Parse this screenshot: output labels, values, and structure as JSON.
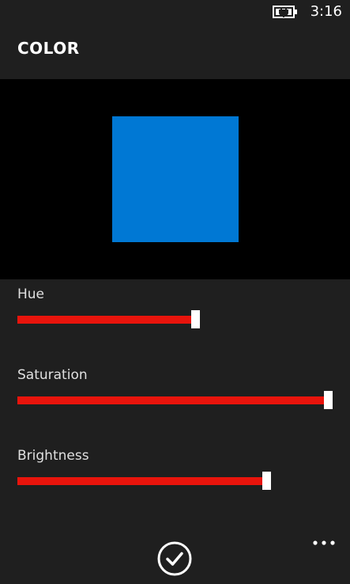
{
  "status_bar": {
    "time": "3:16",
    "battery_icon": "battery-charging-icon"
  },
  "header": {
    "title": "COLOR"
  },
  "preview": {
    "color": "#0078d4"
  },
  "sliders": [
    {
      "label": "Hue",
      "value": 0.565,
      "fill_color": "#e8140c"
    },
    {
      "label": "Saturation",
      "value": 0.985,
      "fill_color": "#e8140c"
    },
    {
      "label": "Brightness",
      "value": 0.79,
      "fill_color": "#e8140c"
    }
  ],
  "app_bar": {
    "confirm_icon": "check-circle-icon",
    "more_icon": "ellipsis-icon"
  }
}
